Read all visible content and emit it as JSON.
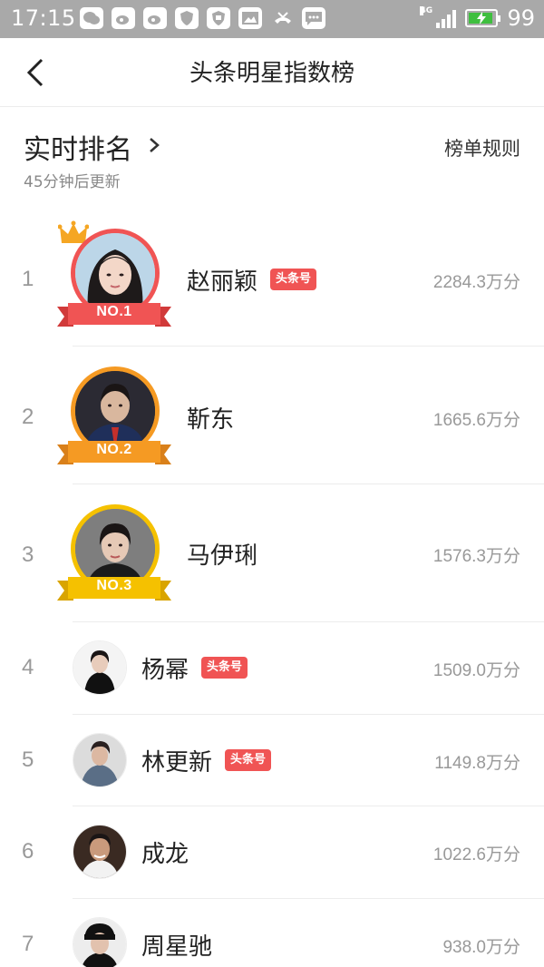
{
  "status_bar": {
    "time": "17:15",
    "network": "4G",
    "battery": "99",
    "icons": [
      "wechat-icon",
      "weibo-icon",
      "weibo-icon",
      "shield-icon",
      "shield-icon",
      "image-icon",
      "missed-call-icon",
      "message-icon"
    ]
  },
  "nav": {
    "title": "头条明星指数榜",
    "back_icon": "chevron-left-icon"
  },
  "header": {
    "section_title": "实时排名",
    "update_note": "45分钟后更新",
    "rules_link": "榜单规则"
  },
  "rankings": [
    {
      "rank": "1",
      "name": "赵丽颖",
      "badge": "头条号",
      "score": "2284.3万分",
      "medal": "NO.1"
    },
    {
      "rank": "2",
      "name": "靳东",
      "badge": "",
      "score": "1665.6万分",
      "medal": "NO.2"
    },
    {
      "rank": "3",
      "name": "马伊琍",
      "badge": "",
      "score": "1576.3万分",
      "medal": "NO.3"
    },
    {
      "rank": "4",
      "name": "杨幂",
      "badge": "头条号",
      "score": "1509.0万分"
    },
    {
      "rank": "5",
      "name": "林更新",
      "badge": "头条号",
      "score": "1149.8万分"
    },
    {
      "rank": "6",
      "name": "成龙",
      "badge": "",
      "score": "1022.6万分"
    },
    {
      "rank": "7",
      "name": "周星驰",
      "badge": "",
      "score": "938.0万分"
    }
  ],
  "colors": {
    "gold_rank1": "#f05454",
    "orange_rank2": "#f59a23",
    "yellow_rank3": "#f5c100",
    "badge": "#f05454",
    "status_bar": "#a9a9a9"
  }
}
